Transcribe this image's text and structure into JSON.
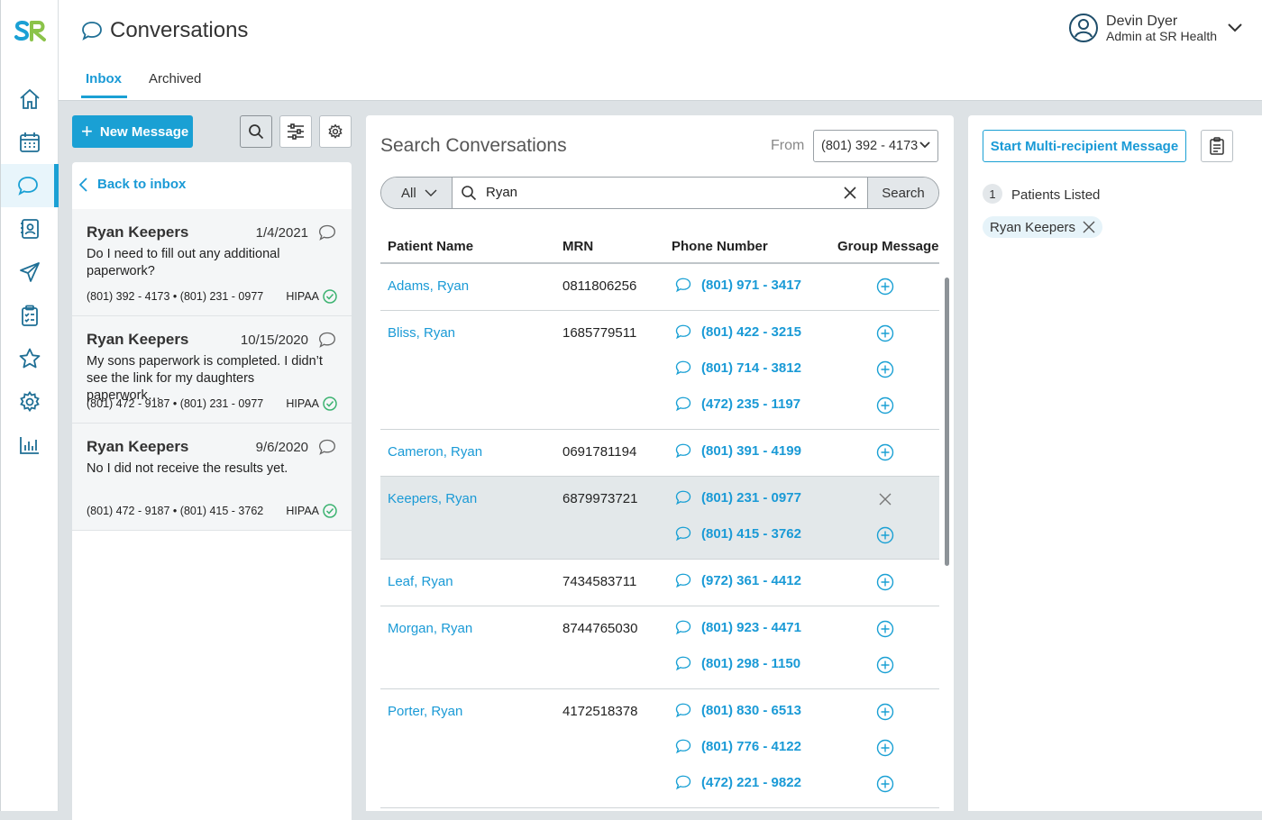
{
  "app": {
    "logo_text": "SR",
    "title": "Conversations"
  },
  "sidebar": {
    "items": [
      {
        "icon": "home-icon"
      },
      {
        "icon": "calendar-icon"
      },
      {
        "icon": "chat-icon",
        "active": true
      },
      {
        "icon": "contacts-icon"
      },
      {
        "icon": "send-icon"
      },
      {
        "icon": "clipboard-icon"
      },
      {
        "icon": "star-icon"
      },
      {
        "icon": "gear-icon"
      },
      {
        "icon": "analytics-icon"
      }
    ]
  },
  "tabs": [
    {
      "label": "Inbox",
      "active": true
    },
    {
      "label": "Archived",
      "active": false
    }
  ],
  "user": {
    "name": "Devin Dyer",
    "role": "Admin at SR Health"
  },
  "inbox": {
    "new_message_label": "New Message",
    "back_label": "Back to inbox",
    "conversations": [
      {
        "name": "Ryan Keepers",
        "date": "1/4/2021",
        "message": "Do I need to fill out any additional paperwork?",
        "from": "(801) 392 - 4173",
        "to": "(801) 231 - 0977",
        "badge": "HIPAA"
      },
      {
        "name": "Ryan Keepers",
        "date": "10/15/2020",
        "message": "My sons paperwork is completed. I didn’t see the link for my daughters paperwork…",
        "from": "(801) 472 - 9187",
        "to": "(801) 231 - 0977",
        "badge": "HIPAA"
      },
      {
        "name": "Ryan Keepers",
        "date": "9/6/2020",
        "message": "No I did not receive the results yet.",
        "from": "(801) 472 - 9187",
        "to": "(801) 415 - 3762",
        "badge": "HIPAA"
      }
    ],
    "separator": "•"
  },
  "search": {
    "title": "Search Conversations",
    "from_label": "From",
    "from_value": "(801) 392 - 4173",
    "filter_value": "All",
    "query": "Ryan",
    "button_label": "Search",
    "columns": [
      "Patient Name",
      "MRN",
      "Phone Number",
      "Group Message"
    ],
    "rows": [
      {
        "name": "Adams, Ryan",
        "mrn": "0811806256",
        "phones": [
          "(801) 971 - 3417"
        ],
        "added": [
          false
        ]
      },
      {
        "name": "Bliss, Ryan",
        "mrn": "1685779511",
        "phones": [
          "(801) 422 - 3215",
          "(801) 714 - 3812",
          "(472) 235 - 1197"
        ],
        "added": [
          false,
          false,
          false
        ]
      },
      {
        "name": "Cameron, Ryan",
        "mrn": "0691781194",
        "phones": [
          "(801) 391 - 4199"
        ],
        "added": [
          false
        ]
      },
      {
        "name": "Keepers, Ryan",
        "mrn": "6879973721",
        "phones": [
          "(801) 231 - 0977",
          "(801) 415 - 3762"
        ],
        "added": [
          true,
          false
        ],
        "highlighted": true
      },
      {
        "name": "Leaf, Ryan",
        "mrn": "7434583711",
        "phones": [
          "(972) 361 - 4412"
        ],
        "added": [
          false
        ]
      },
      {
        "name": "Morgan, Ryan",
        "mrn": "8744765030",
        "phones": [
          "(801) 923 - 4471",
          "(801) 298 - 1150"
        ],
        "added": [
          false,
          false
        ]
      },
      {
        "name": "Porter, Ryan",
        "mrn": "4172518378",
        "phones": [
          "(801) 830 - 6513",
          "(801) 776 - 4122",
          "(472) 221 - 9822"
        ],
        "added": [
          false,
          false,
          false
        ]
      }
    ]
  },
  "multi": {
    "button_label": "Start Multi-recipient Message",
    "count": "1",
    "count_label": "Patients Listed",
    "recipients": [
      "Ryan Keepers"
    ]
  },
  "colors": {
    "accent": "#1aa0d4",
    "link": "#1a9ad6",
    "success": "#3cb371",
    "highlight_row": "#e3e8ea"
  }
}
